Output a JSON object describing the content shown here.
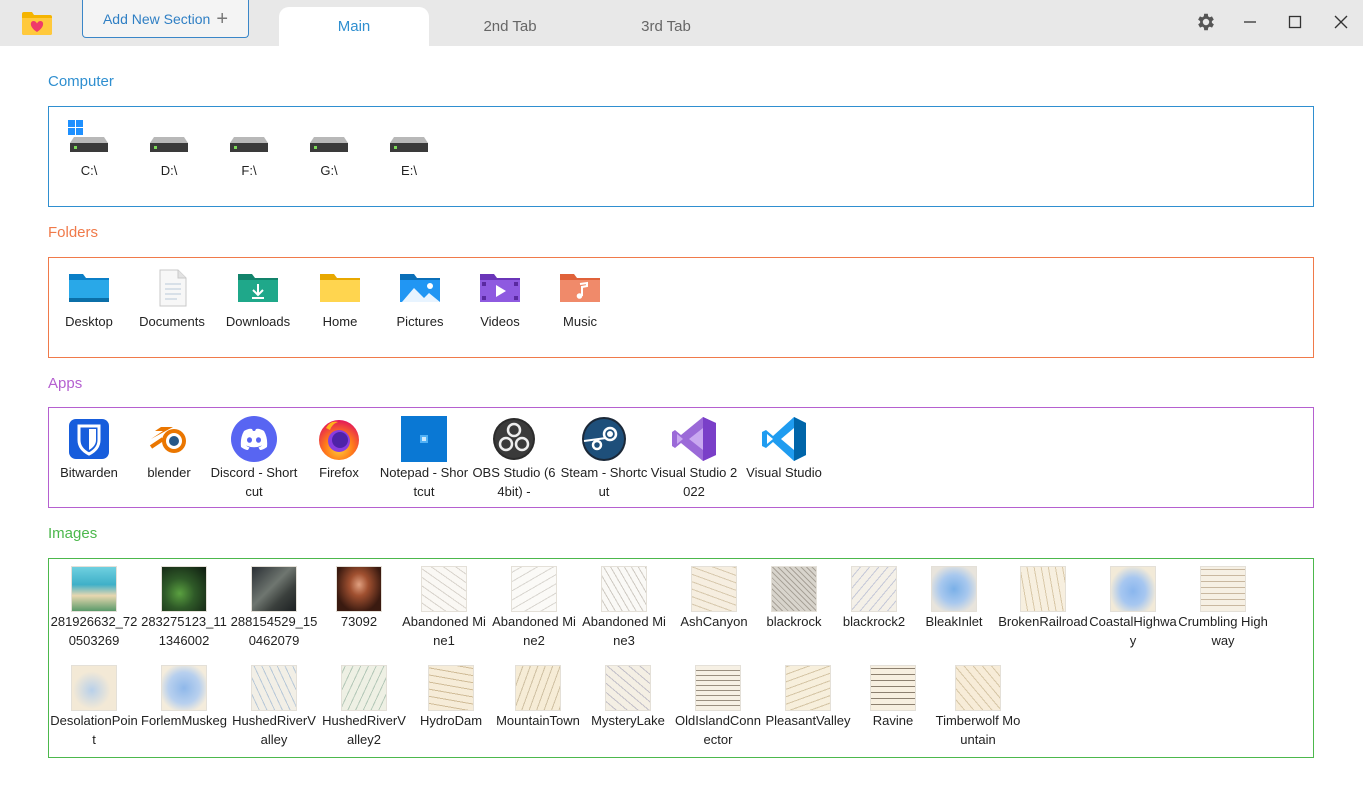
{
  "titlebar": {
    "add_section_label": "Add New Section",
    "add_section_icon": "plus-icon",
    "tabs": [
      "Main",
      "2nd Tab",
      "3rd Tab"
    ],
    "active_tab": "Main"
  },
  "sections": {
    "computer": {
      "title": "Computer",
      "color": "#2f8fd0",
      "items": [
        "C:\\",
        "D:\\",
        "F:\\",
        "G:\\",
        "E:\\"
      ]
    },
    "folders": {
      "title": "Folders",
      "color": "#f07a4a",
      "items": [
        "Desktop",
        "Documents",
        "Downloads",
        "Home",
        "Pictures",
        "Videos",
        "Music"
      ]
    },
    "apps": {
      "title": "Apps",
      "color": "#b560d0",
      "items": [
        "Bitwarden",
        "blender",
        "Discord - Shortcut",
        "Firefox",
        "Notepad - Shortcut",
        "OBS Studio (64bit) -",
        "Steam - Shortcut",
        "Visual Studio 2022",
        "Visual Studio"
      ]
    },
    "images": {
      "title": "Images",
      "color": "#4cb84c",
      "row1": [
        "281926632_720503269",
        "283275123_111346002",
        "288154529_150462079",
        "73092",
        "Abandoned Mine1",
        "Abandoned Mine2",
        "Abandoned Mine3",
        "AshCanyon",
        "blackrock",
        "blackrock2",
        "BleakInlet",
        "BrokenRailroad",
        "CoastalHighway",
        "Crumbling Highway"
      ],
      "row2": [
        "DesolationPoint",
        "ForlemMuskeg",
        "HushedRiverValley",
        "HushedRiverValley2",
        "HydroDam",
        "MountainTown",
        "MysteryLake",
        "OldIslandConnector",
        "PleasantValley",
        "Ravine",
        "Timberwolf Mountain"
      ]
    }
  }
}
